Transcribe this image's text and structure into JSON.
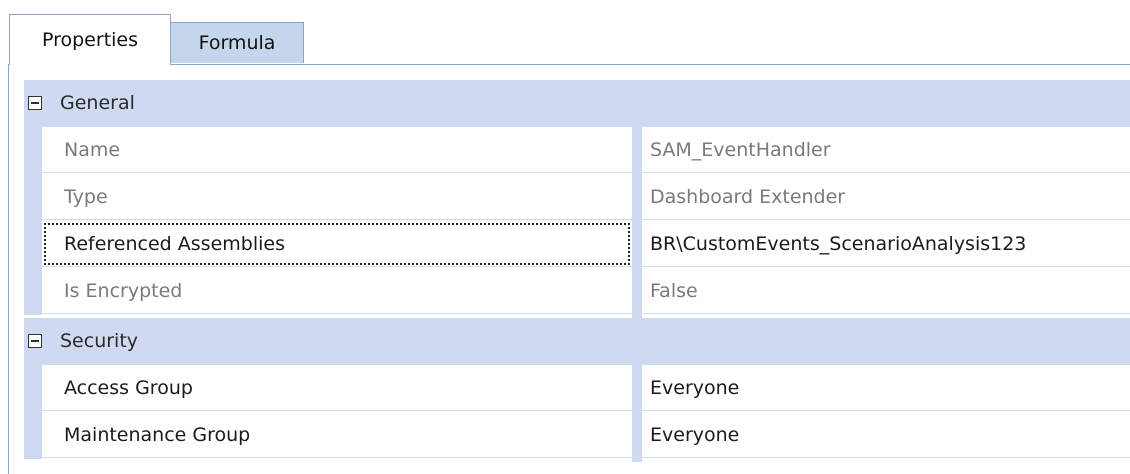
{
  "tabs": [
    {
      "label": "Properties",
      "active": true
    },
    {
      "label": "Formula",
      "active": false
    }
  ],
  "categories": [
    {
      "label": "General",
      "expanded": true,
      "properties": [
        {
          "name": "Name",
          "value": "SAM_EventHandler",
          "readonly": true
        },
        {
          "name": "Type",
          "value": "Dashboard Extender",
          "readonly": true
        },
        {
          "name": "Referenced Assemblies",
          "value": "BR\\CustomEvents_ScenarioAnalysis123",
          "readonly": false,
          "focused": true
        },
        {
          "name": "Is Encrypted",
          "value": "False",
          "readonly": true
        }
      ]
    },
    {
      "label": "Security",
      "expanded": true,
      "properties": [
        {
          "name": "Access Group",
          "value": "Everyone",
          "readonly": false
        },
        {
          "name": "Maintenance Group",
          "value": "Everyone",
          "readonly": false
        }
      ]
    }
  ],
  "colors": {
    "category_bg": "#cfdaf1",
    "tab_inactive_bg": "#c5d6ec",
    "border": "#8fa6c8",
    "readonly_text": "#7a7a7a"
  }
}
